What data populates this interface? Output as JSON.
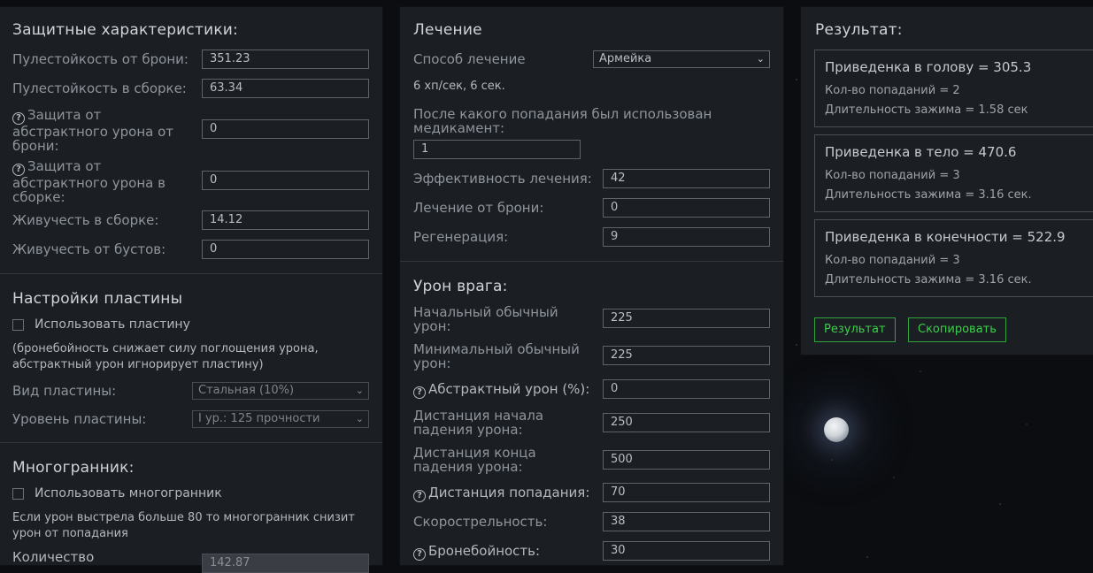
{
  "defense": {
    "title": "Защитные характеристики:",
    "armor_bullet_label": "Пулестойкость от брони:",
    "armor_bullet_value": "351.23",
    "build_bullet_label": "Пулестойкость в сборке:",
    "build_bullet_value": "63.34",
    "abstract_armor_label": "Защита от абстрактного урона от брони:",
    "abstract_armor_value": "0",
    "abstract_build_label": "Защита от абстрактного урона в сборке:",
    "abstract_build_value": "0",
    "vitality_build_label": "Живучесть в сборке:",
    "vitality_build_value": "14.12",
    "vitality_boost_label": "Живучесть от бустов:",
    "vitality_boost_value": "0"
  },
  "plate": {
    "title": "Настройки пластины",
    "use_label": "Использовать пластину",
    "note": "(бронебойность снижает силу поглощения урона, абстрактный урон игнорирует пластину)",
    "type_label": "Вид пластины:",
    "type_value": "Стальная (10%)",
    "level_label": "Уровень пластины:",
    "level_value": "I ур.: 125 прочности"
  },
  "polyhedron": {
    "title": "Многогранник:",
    "use_label": "Использовать многогранник",
    "note": "Если урон выстрела больше 80 то многогранник снизит урон от попадания",
    "count_label": "Количество",
    "count_value": "142.87"
  },
  "healing": {
    "title": "Лечение",
    "method_label": "Способ лечение",
    "method_value": "Армейка",
    "rate_text": "6 хп/сек, 6 сек.",
    "after_hit_label": "После какого попадания был использован медикамент:",
    "after_hit_value": "1",
    "efficiency_label": "Эффективность лечения:",
    "efficiency_value": "42",
    "armor_heal_label": "Лечение от брони:",
    "armor_heal_value": "0",
    "regen_label": "Регенерация:",
    "regen_value": "9"
  },
  "enemy": {
    "title": "Урон врага:",
    "start_dmg_label": "Начальный обычный урон:",
    "start_dmg_value": "225",
    "min_dmg_label": "Минимальный обычный урон:",
    "min_dmg_value": "225",
    "abstract_label": "Абстрактный урон (%):",
    "abstract_value": "0",
    "falloff_start_label": "Дистанция начала падения урона:",
    "falloff_start_value": "250",
    "falloff_end_label": "Дистанция конца падения урона:",
    "falloff_end_value": "500",
    "hit_dist_label": "Дистанция попадания:",
    "hit_dist_value": "70",
    "rate_label": "Скорострельность:",
    "rate_value": "38",
    "penetration_label": "Бронебойность:",
    "penetration_value": "30"
  },
  "result": {
    "title": "Результат:",
    "head": {
      "title": "Приведенка в голову = 305.3",
      "hits": "Кол-во попаданий = 2",
      "duration": "Длительность зажима = 1.58 сек"
    },
    "body": {
      "title": "Приведенка в тело = 470.6",
      "hits": "Кол-во попаданий = 3",
      "duration": "Длительность зажима = 3.16 сек."
    },
    "limbs": {
      "title": "Приведенка в конечности = 522.9",
      "hits": "Кол-во попаданий = 3",
      "duration": "Длительность зажима = 3.16 сек."
    },
    "result_button": "Результат",
    "copy_button": "Скопировать"
  },
  "icons": {
    "help": "help-circle-icon",
    "dropdown": "chevron-down-icon"
  }
}
